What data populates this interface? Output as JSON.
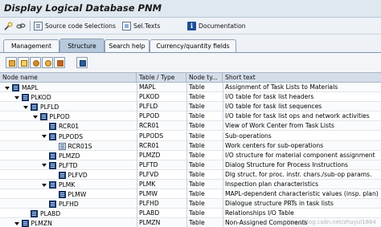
{
  "window": {
    "title": "Display Logical Database PNM"
  },
  "toolbar": {
    "source_code_label": "Source code",
    "selections_label": "Selections",
    "sel_texts_label": "Sel.Texts",
    "documentation_label": "Documentation"
  },
  "tabs": [
    {
      "label": "Management",
      "active": false
    },
    {
      "label": "Structure",
      "active": true
    },
    {
      "label": "Search help",
      "active": false
    },
    {
      "label": "Currency/quantity fields",
      "active": false
    }
  ],
  "table": {
    "columns": [
      "Node name",
      "Table / Type",
      "Node ty...",
      "Short text"
    ],
    "rows": [
      {
        "node": "MAPL",
        "table": "MAPL",
        "type": "Table",
        "text": "Assignment of Task Lists to Materials",
        "level": 0,
        "expanded": true,
        "icon": "table-node-icon"
      },
      {
        "node": "PLKOD",
        "table": "PLKOD",
        "type": "Table",
        "text": "I/O table for task list headers",
        "level": 1,
        "expanded": true,
        "icon": "table-node-icon"
      },
      {
        "node": "PLFLD",
        "table": "PLFLD",
        "type": "Table",
        "text": "I/O table for task list sequences",
        "level": 2,
        "expanded": true,
        "icon": "table-node-icon"
      },
      {
        "node": "PLPOD",
        "table": "PLPOD",
        "type": "Table",
        "text": "I/O table for task list ops and network activities",
        "level": 3,
        "expanded": true,
        "icon": "table-node-icon"
      },
      {
        "node": "RCR01",
        "table": "RCR01",
        "type": "Table",
        "text": "View of Work Center from Task Lists",
        "level": 4,
        "expanded": false,
        "icon": "table-node-icon"
      },
      {
        "node": "PLPODS",
        "table": "PLPODS",
        "type": "Table",
        "text": "Sub-operations",
        "level": 4,
        "expanded": true,
        "icon": "table-node-icon"
      },
      {
        "node": "RCR01S",
        "table": "RCR01",
        "type": "Table",
        "text": "Work centers for sub-operations",
        "level": 5,
        "expanded": false,
        "icon": "table-node-icon-light"
      },
      {
        "node": "PLMZD",
        "table": "PLMZD",
        "type": "Table",
        "text": "I/O structure for material component assignment",
        "level": 4,
        "expanded": false,
        "icon": "table-node-icon"
      },
      {
        "node": "PLFTD",
        "table": "PLFTD",
        "type": "Table",
        "text": "Dialog Structure for Process Instructions",
        "level": 4,
        "expanded": true,
        "icon": "table-node-icon"
      },
      {
        "node": "PLFVD",
        "table": "PLFVD",
        "type": "Table",
        "text": "Dlg struct. for proc. instr. chars./sub-op params.",
        "level": 5,
        "expanded": false,
        "icon": "table-node-icon"
      },
      {
        "node": "PLMK",
        "table": "PLMK",
        "type": "Table",
        "text": "Inspection plan characteristics",
        "level": 4,
        "expanded": true,
        "icon": "table-node-icon"
      },
      {
        "node": "PLMW",
        "table": "PLMW",
        "type": "Table",
        "text": "MAPL-dependent characteristic values (insp. plan)",
        "level": 5,
        "expanded": false,
        "icon": "table-node-icon"
      },
      {
        "node": "PLFHD",
        "table": "PLFHD",
        "type": "Table",
        "text": "Dialogue structure PRTs in task lists",
        "level": 4,
        "expanded": false,
        "icon": "table-node-icon"
      },
      {
        "node": "PLABD",
        "table": "PLABD",
        "type": "Table",
        "text": "Relationships I/O Table",
        "level": 2,
        "expanded": false,
        "icon": "table-node-icon"
      },
      {
        "node": "PLMZN",
        "table": "PLMZN",
        "type": "Table",
        "text": "Non-Assigned Components",
        "level": 1,
        "expanded": true,
        "icon": "table-node-icon"
      }
    ]
  },
  "watermark": "https://blog.csdn.net/zhuyul1864"
}
